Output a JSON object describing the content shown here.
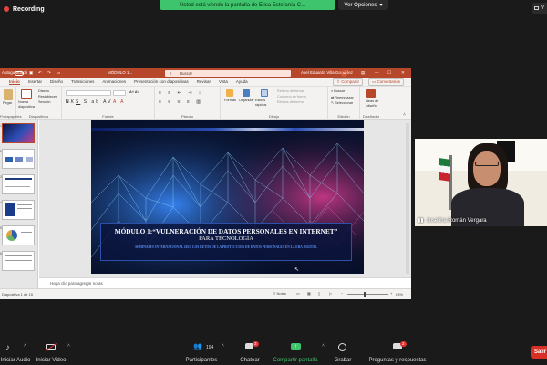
{
  "zoom": {
    "recording_label": "Recording",
    "share_banner": "Usted está viendo la pantalla de Elisa Estefanía C...",
    "view_options": "Ver Opciones",
    "view_right": "V",
    "participant_name": "Josefina Román Vergara",
    "participants_count": "194",
    "chat_badge": "3",
    "qa_badge": "2",
    "end_label": "Salir",
    "controls": [
      {
        "label": "Iniciar Audio"
      },
      {
        "label": "Iniciar Video"
      },
      {
        "label": "Participantes"
      },
      {
        "label": "Chatear"
      },
      {
        "label": "Compartir pantalla"
      },
      {
        "label": "Grabar"
      },
      {
        "label": "Preguntas y respuestas"
      }
    ],
    "colors": {
      "share_green": "#3ec46d",
      "end_red": "#d93025",
      "badge_red": "#e02f2f"
    }
  },
  "ppt": {
    "autosave": "Autoguardado",
    "file_name": "MÓDULO 1...",
    "search_placeholder": "Buscar",
    "user_name": "Axel Eduardo Villa González",
    "user_initials": "AE",
    "tabs": [
      "Inicio",
      "Insertar",
      "Diseño",
      "Transiciones",
      "Animaciones",
      "Presentación con diapositivas",
      "Revisar",
      "Vista",
      "Ayuda"
    ],
    "active_tab": "Inicio",
    "share_btn": "Compartir",
    "comments_btn": "Comentarios",
    "ribbon": {
      "paste": "Pegar",
      "new_slide": "Nueva diapositiva",
      "layout": "Diseño",
      "reset": "Restablecer",
      "section": "Sección",
      "shapes": "Formas",
      "arrange": "Organizar",
      "quick_styles": "Estilos rápidos",
      "fill": "Relleno de forma",
      "outline": "Contorno de forma",
      "effects": "Efectos de forma",
      "find": "Buscar",
      "replace": "Reemplazar",
      "select": "Seleccionar",
      "designer": "Ideas de diseño",
      "groups": {
        "clipboard": "Portapapeles",
        "slides": "Diapositivas",
        "font": "Fuente",
        "paragraph": "Párrafo",
        "drawing": "Dibujo",
        "editing": "Edición",
        "designer": "Diseñador"
      }
    },
    "thumb_numbers": [
      "1",
      "2",
      "3",
      "4",
      "5",
      "6"
    ],
    "notes_placeholder": "Haga clic para agregar notas",
    "status": {
      "slide_of": "Diapositiva 1 de 15",
      "notes": "Notas",
      "zoom": "63%"
    },
    "slide": {
      "title": "MÓDULO 1:“VULNERACIÓN DE DATOS PERSONALES EN INTERNET”",
      "subtitle": "PARA TECNOLOGÍA",
      "caption": "SEMINARIO INTERNACIONAL 2021: LOS RETOS DE LA PROTECCIÓN DE DATOS PERSONALES EN LA ERA DIGITAL"
    },
    "colors": {
      "accent": "#b7472a"
    }
  }
}
